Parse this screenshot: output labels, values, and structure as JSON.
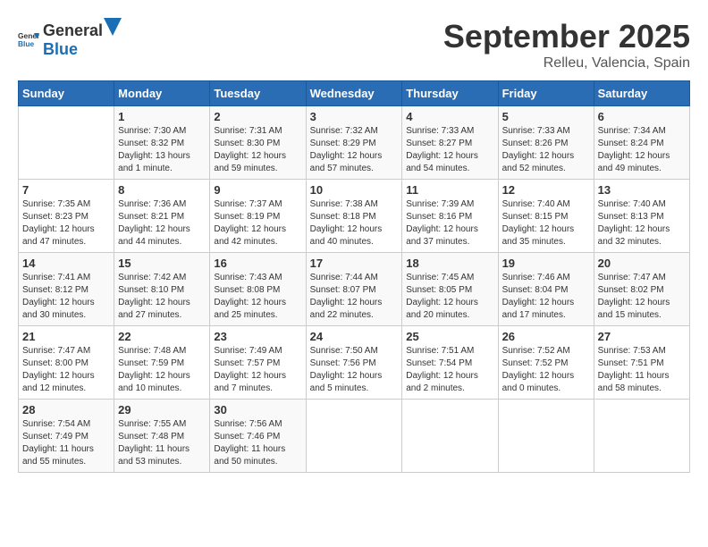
{
  "logo": {
    "text_general": "General",
    "text_blue": "Blue"
  },
  "title": "September 2025",
  "subtitle": "Relleu, Valencia, Spain",
  "days_of_week": [
    "Sunday",
    "Monday",
    "Tuesday",
    "Wednesday",
    "Thursday",
    "Friday",
    "Saturday"
  ],
  "weeks": [
    [
      {
        "day": "",
        "info": ""
      },
      {
        "day": "1",
        "info": "Sunrise: 7:30 AM\nSunset: 8:32 PM\nDaylight: 13 hours and 1 minute."
      },
      {
        "day": "2",
        "info": "Sunrise: 7:31 AM\nSunset: 8:30 PM\nDaylight: 12 hours and 59 minutes."
      },
      {
        "day": "3",
        "info": "Sunrise: 7:32 AM\nSunset: 8:29 PM\nDaylight: 12 hours and 57 minutes."
      },
      {
        "day": "4",
        "info": "Sunrise: 7:33 AM\nSunset: 8:27 PM\nDaylight: 12 hours and 54 minutes."
      },
      {
        "day": "5",
        "info": "Sunrise: 7:33 AM\nSunset: 8:26 PM\nDaylight: 12 hours and 52 minutes."
      },
      {
        "day": "6",
        "info": "Sunrise: 7:34 AM\nSunset: 8:24 PM\nDaylight: 12 hours and 49 minutes."
      }
    ],
    [
      {
        "day": "7",
        "info": "Sunrise: 7:35 AM\nSunset: 8:23 PM\nDaylight: 12 hours and 47 minutes."
      },
      {
        "day": "8",
        "info": "Sunrise: 7:36 AM\nSunset: 8:21 PM\nDaylight: 12 hours and 44 minutes."
      },
      {
        "day": "9",
        "info": "Sunrise: 7:37 AM\nSunset: 8:19 PM\nDaylight: 12 hours and 42 minutes."
      },
      {
        "day": "10",
        "info": "Sunrise: 7:38 AM\nSunset: 8:18 PM\nDaylight: 12 hours and 40 minutes."
      },
      {
        "day": "11",
        "info": "Sunrise: 7:39 AM\nSunset: 8:16 PM\nDaylight: 12 hours and 37 minutes."
      },
      {
        "day": "12",
        "info": "Sunrise: 7:40 AM\nSunset: 8:15 PM\nDaylight: 12 hours and 35 minutes."
      },
      {
        "day": "13",
        "info": "Sunrise: 7:40 AM\nSunset: 8:13 PM\nDaylight: 12 hours and 32 minutes."
      }
    ],
    [
      {
        "day": "14",
        "info": "Sunrise: 7:41 AM\nSunset: 8:12 PM\nDaylight: 12 hours and 30 minutes."
      },
      {
        "day": "15",
        "info": "Sunrise: 7:42 AM\nSunset: 8:10 PM\nDaylight: 12 hours and 27 minutes."
      },
      {
        "day": "16",
        "info": "Sunrise: 7:43 AM\nSunset: 8:08 PM\nDaylight: 12 hours and 25 minutes."
      },
      {
        "day": "17",
        "info": "Sunrise: 7:44 AM\nSunset: 8:07 PM\nDaylight: 12 hours and 22 minutes."
      },
      {
        "day": "18",
        "info": "Sunrise: 7:45 AM\nSunset: 8:05 PM\nDaylight: 12 hours and 20 minutes."
      },
      {
        "day": "19",
        "info": "Sunrise: 7:46 AM\nSunset: 8:04 PM\nDaylight: 12 hours and 17 minutes."
      },
      {
        "day": "20",
        "info": "Sunrise: 7:47 AM\nSunset: 8:02 PM\nDaylight: 12 hours and 15 minutes."
      }
    ],
    [
      {
        "day": "21",
        "info": "Sunrise: 7:47 AM\nSunset: 8:00 PM\nDaylight: 12 hours and 12 minutes."
      },
      {
        "day": "22",
        "info": "Sunrise: 7:48 AM\nSunset: 7:59 PM\nDaylight: 12 hours and 10 minutes."
      },
      {
        "day": "23",
        "info": "Sunrise: 7:49 AM\nSunset: 7:57 PM\nDaylight: 12 hours and 7 minutes."
      },
      {
        "day": "24",
        "info": "Sunrise: 7:50 AM\nSunset: 7:56 PM\nDaylight: 12 hours and 5 minutes."
      },
      {
        "day": "25",
        "info": "Sunrise: 7:51 AM\nSunset: 7:54 PM\nDaylight: 12 hours and 2 minutes."
      },
      {
        "day": "26",
        "info": "Sunrise: 7:52 AM\nSunset: 7:52 PM\nDaylight: 12 hours and 0 minutes."
      },
      {
        "day": "27",
        "info": "Sunrise: 7:53 AM\nSunset: 7:51 PM\nDaylight: 11 hours and 58 minutes."
      }
    ],
    [
      {
        "day": "28",
        "info": "Sunrise: 7:54 AM\nSunset: 7:49 PM\nDaylight: 11 hours and 55 minutes."
      },
      {
        "day": "29",
        "info": "Sunrise: 7:55 AM\nSunset: 7:48 PM\nDaylight: 11 hours and 53 minutes."
      },
      {
        "day": "30",
        "info": "Sunrise: 7:56 AM\nSunset: 7:46 PM\nDaylight: 11 hours and 50 minutes."
      },
      {
        "day": "",
        "info": ""
      },
      {
        "day": "",
        "info": ""
      },
      {
        "day": "",
        "info": ""
      },
      {
        "day": "",
        "info": ""
      }
    ]
  ]
}
